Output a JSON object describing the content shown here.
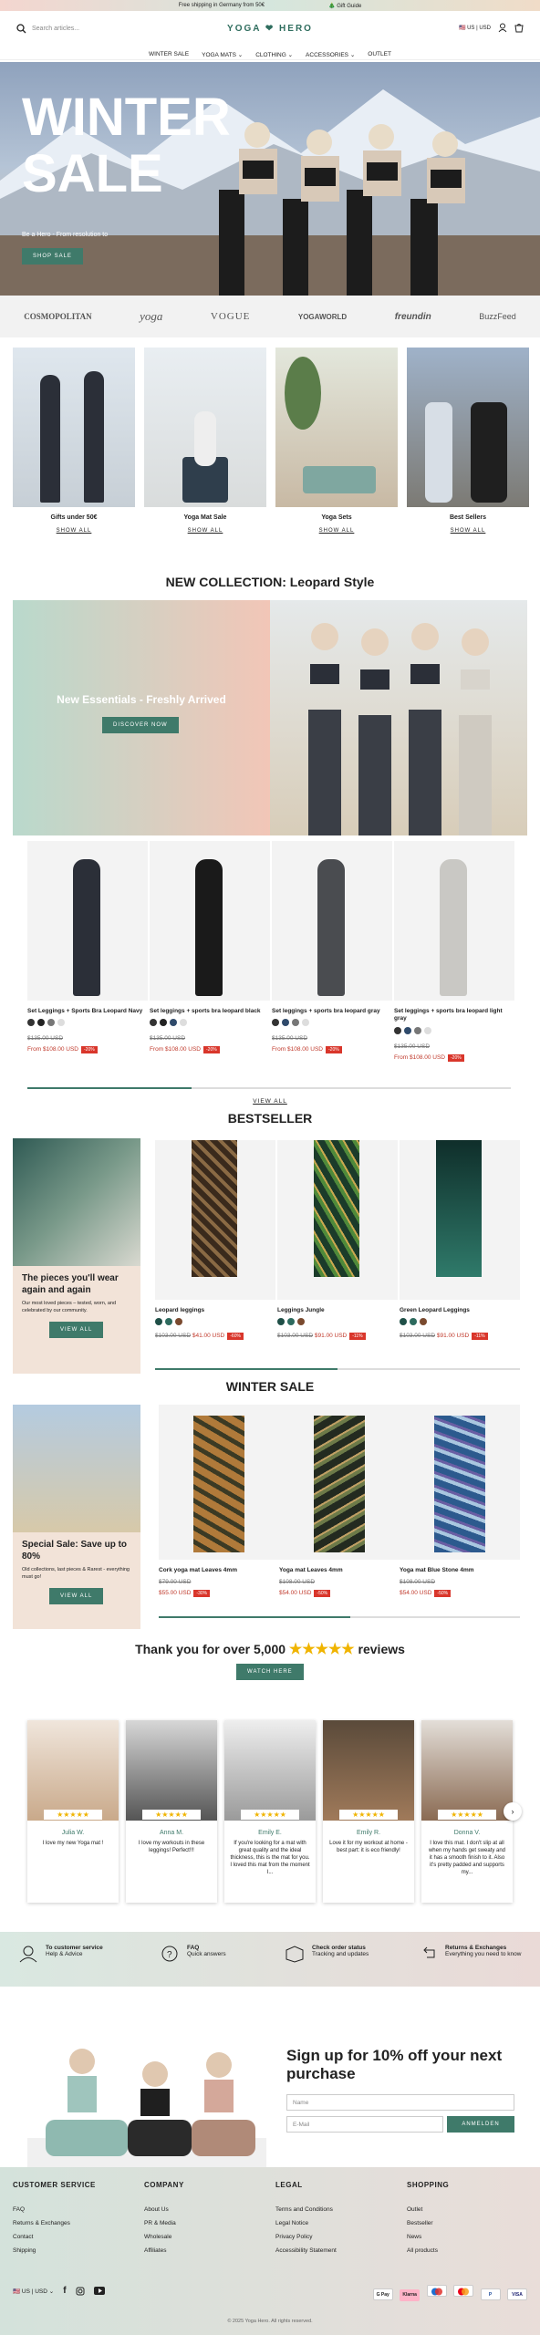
{
  "announcement": {
    "left": "Free shipping in Germany from 50€",
    "right": "Gift Guide"
  },
  "header": {
    "search_placeholder": "Search articles...",
    "logo": "YOGA ❤ HERO",
    "currency": "US | USD"
  },
  "nav": [
    "WINTER SALE",
    "YOGA MATS",
    "CLOTHING",
    "ACCESSORIES",
    "OUTLET"
  ],
  "hero": {
    "title1": "WINTER",
    "title2": "SALE",
    "subtitle": "Be a Hero - From resolution to",
    "button": "SHOP SALE"
  },
  "press": [
    "COSMOPOLITAN",
    "yoga",
    "VOGUE",
    "YOGAWORLD",
    "freundin",
    "BuzzFeed"
  ],
  "categories": [
    {
      "title": "Gifts under 50€",
      "link": "SHOW ALL"
    },
    {
      "title": "Yoga Mat Sale",
      "link": "SHOW ALL"
    },
    {
      "title": "Yoga Sets",
      "link": "SHOW ALL"
    },
    {
      "title": "Best Sellers",
      "link": "SHOW ALL"
    }
  ],
  "collection": {
    "title": "NEW COLLECTION: Leopard Style",
    "banner_title": "New Essentials - Freshly Arrived",
    "banner_button": "DISCOVER NOW"
  },
  "products1": [
    {
      "name": "Set Leggings + Sports Bra Leopard Navy",
      "old": "$135.00 USD",
      "new": "From $108.00 USD",
      "badge": "-20%",
      "colors": [
        "#333",
        "#222",
        "#777",
        "#ddd"
      ]
    },
    {
      "name": "Set leggings + sports bra leopard black",
      "old": "$135.00 USD",
      "new": "From $108.00 USD",
      "badge": "-20%",
      "colors": [
        "#333",
        "#222",
        "#2f4a6b",
        "#ddd"
      ]
    },
    {
      "name": "Set leggings + sports bra leopard gray",
      "old": "$135.00 USD",
      "new": "From $108.00 USD",
      "badge": "-20%",
      "colors": [
        "#333",
        "#2f4a6b",
        "#777",
        "#ddd"
      ]
    },
    {
      "name": "Set leggings + sports bra leopard light gray",
      "old": "$135.00 USD",
      "new": "From $108.00 USD",
      "badge": "-20%",
      "colors": [
        "#333",
        "#2f4a6b",
        "#777",
        "#ddd"
      ]
    }
  ],
  "view_all": "VIEW ALL",
  "bestseller": {
    "title": "BESTSELLER",
    "promo_title": "The pieces you'll wear again and again",
    "promo_text": "Our most loved pieces – tested, worn, and celebrated by our community.",
    "promo_button": "VIEW ALL",
    "products": [
      {
        "name": "Leopard leggings",
        "old": "$103.00 USD",
        "new": "$41.00 USD",
        "badge": "-60%",
        "colors": [
          "#1f4f47",
          "#2d6a5e",
          "#7a4a2f"
        ]
      },
      {
        "name": "Leggings Jungle",
        "old": "$103.00 USD",
        "new": "$91.00 USD",
        "badge": "-11%",
        "colors": [
          "#1f4f47",
          "#2d6a5e",
          "#7a4a2f"
        ]
      },
      {
        "name": "Green Leopard Leggings",
        "old": "$103.00 USD",
        "new": "$91.00 USD",
        "badge": "-11%",
        "colors": [
          "#1f4f47",
          "#2d6a5e",
          "#7a4a2f"
        ]
      }
    ]
  },
  "winter": {
    "title": "WINTER SALE",
    "promo_title": "Special Sale: Save up to 80%",
    "promo_text": "Old collections, last pieces & Rarest - everything must go!",
    "promo_button": "VIEW ALL",
    "products": [
      {
        "name": "Cork yoga mat Leaves 4mm",
        "old": "$79.00 USD",
        "new": "$55.00 USD",
        "badge": "-30%"
      },
      {
        "name": "Yoga mat Leaves 4mm",
        "old": "$108.00 USD",
        "new": "$54.00 USD",
        "badge": "-50%"
      },
      {
        "name": "Yoga mat Blue Stone 4mm",
        "old": "$108.00 USD",
        "new": "$54.00 USD",
        "badge": "-50%"
      }
    ]
  },
  "reviews": {
    "title_pre": "Thank you for over 5,000",
    "stars": "★★★★★",
    "title_post": "reviews",
    "button": "WATCH HERE",
    "items": [
      {
        "name": "Julia W.",
        "text": "I love my new Yoga mat !"
      },
      {
        "name": "Anna M.",
        "text": "I love my workouts in these leggings! Perfect!!!"
      },
      {
        "name": "Emily E.",
        "text": "If you're looking for a mat with great quality and the ideal thickness, this is the mat for you. I loved this mat from the moment I..."
      },
      {
        "name": "Emily R.",
        "text": "Love it for my workout at home - best part: it is eco friendly!"
      },
      {
        "name": "Donna V.",
        "text": "I love this mat. I don't slip at all when my hands get sweaty and it has a smooth finish to it. Also it's pretty padded and supports my..."
      }
    ]
  },
  "services": [
    {
      "title": "To customer service",
      "sub": "Help & Advice"
    },
    {
      "title": "FAQ",
      "sub": "Quick answers"
    },
    {
      "title": "Check order status",
      "sub": "Tracking and updates"
    },
    {
      "title": "Returns & Exchanges",
      "sub": "Everything you need to know"
    }
  ],
  "newsletter": {
    "title": "Sign up for 10% off your next purchase",
    "name_ph": "Name",
    "email_ph": "E-Mail",
    "button": "ANMELDEN"
  },
  "footer": {
    "cols": [
      {
        "title": "CUSTOMER SERVICE",
        "links": [
          "FAQ",
          "Returns & Exchanges",
          "Contact",
          "Shipping"
        ]
      },
      {
        "title": "COMPANY",
        "links": [
          "About Us",
          "PR & Media",
          "Wholesale",
          "Affiliates"
        ]
      },
      {
        "title": "LEGAL",
        "links": [
          "Terms and Conditions",
          "Legal Notice",
          "Privacy Policy",
          "Accessibility Statement"
        ]
      },
      {
        "title": "SHOPPING",
        "links": [
          "Outlet",
          "Bestseller",
          "News",
          "All products"
        ]
      }
    ],
    "currency": "US | USD",
    "payments": [
      "G Pay",
      "Klarna",
      "",
      "",
      "P",
      "VISA"
    ],
    "copyright": "© 2025 Yoga Hero. All rights reserved."
  }
}
